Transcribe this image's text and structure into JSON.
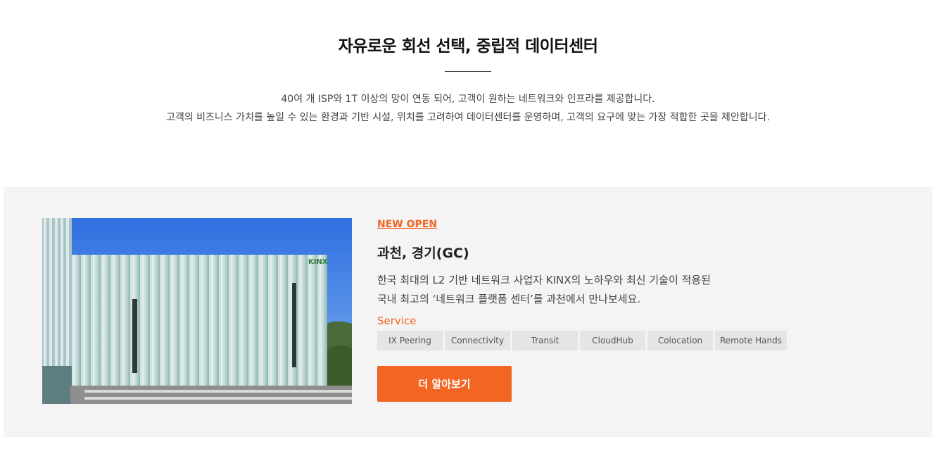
{
  "intro": {
    "title": "자유로운 회선 선택, 중립적 데이터센터",
    "desc_line1": "40여 개 ISP와 1T 이상의 망이 연동 되어, 고객이 원하는 네트워크와 인프라를 제공합니다.",
    "desc_line2": "고객의 비즈니스 가치를 높일 수 있는 환경과 기반 시설, 위치를 고려하여 데이터센터를 운영하며, 고객의 요구에 맞는 가장 적합한 곳을 제안합니다."
  },
  "card": {
    "badge": "NEW OPEN",
    "location": "과천, 경기(GC)",
    "body_line1": "한국 최대의 L2 기반 네트워크 사업자 KINX의 노하우와 최신 기술이 적용된",
    "body_line2": "국내 최고의 ‘네트워크 플랫폼 센터’를 과천에서 만나보세요.",
    "service_label": "Service",
    "tags": [
      "IX Peering",
      "Connectivity",
      "Transit",
      "CloudHub",
      "Colocation",
      "Remote Hands"
    ],
    "cta_label": "더 알아보기",
    "building_sign": "KINX"
  },
  "colors": {
    "accent": "#f26522",
    "card_bg": "#f4f4f4",
    "tag_bg": "#e5e5e5"
  }
}
